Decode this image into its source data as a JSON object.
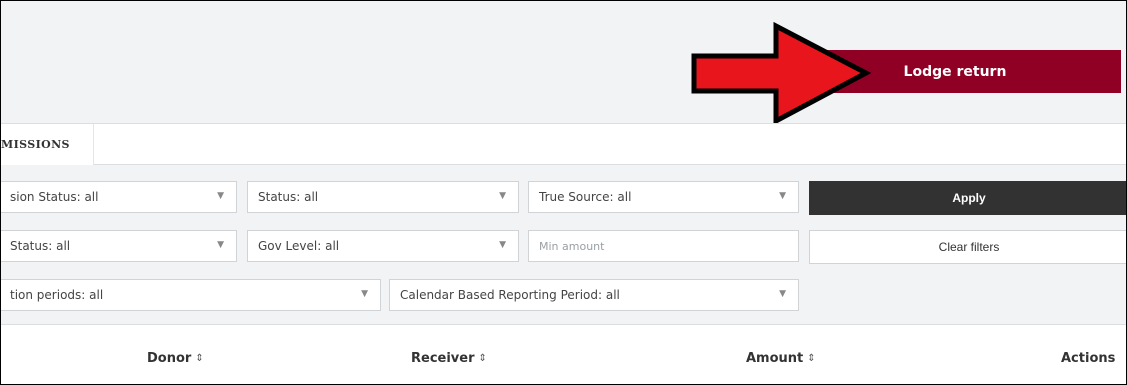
{
  "header": {
    "lodge_label": "Lodge return"
  },
  "tabs": {
    "active_label": "MISSIONS"
  },
  "filters": {
    "row1": {
      "submission_status": "sion Status: all",
      "status": "Status: all",
      "true_source": "True Source: all",
      "apply_label": "Apply"
    },
    "row2": {
      "x_status": "Status: all",
      "gov_level": "Gov Level: all",
      "min_amount_placeholder": "Min amount",
      "clear_label": "Clear filters"
    },
    "row3": {
      "periods": "tion periods: all",
      "calendar_period": "Calendar Based Reporting Period: all"
    }
  },
  "table": {
    "columns": [
      "Donor",
      "Receiver",
      "Amount",
      "Actions"
    ]
  },
  "icons": {
    "sort": "sort-icon",
    "caret": "chevron-down-icon",
    "annotation": "red-arrow-icon"
  },
  "colors": {
    "lodge_button": "#900024",
    "apply_button": "#323232",
    "annotation_arrow": "#e8161c"
  }
}
